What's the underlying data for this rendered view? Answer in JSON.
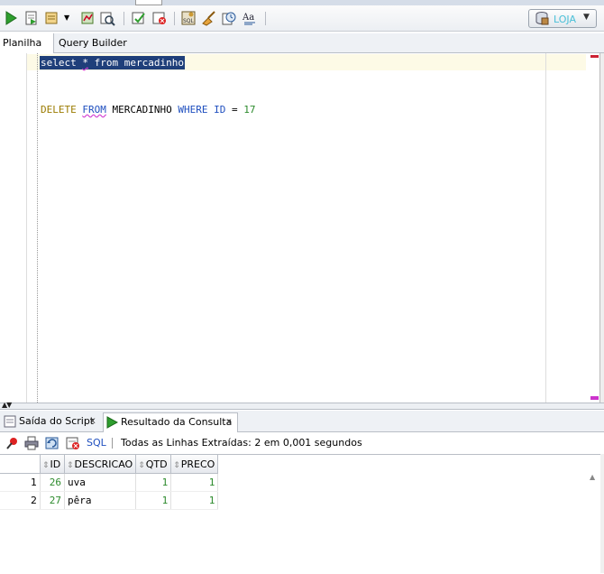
{
  "toolbar": {
    "icons": [
      "run-statement-icon",
      "run-script-icon",
      "commit-dropdown-icon",
      "explain-plan-icon",
      "autotrace-icon",
      "commit-icon",
      "rollback-icon",
      "sql-tuning-icon",
      "clear-icon",
      "history-icon",
      "format-icon"
    ],
    "connection_label": "LOJA"
  },
  "subtabs": {
    "worksheet": "Planilha",
    "query_builder": "Query Builder"
  },
  "editor": {
    "line1": {
      "kw1": "select",
      "star": "*",
      "kw2": "from",
      "table": "mercadinho"
    },
    "line2": {
      "kw1": "DELETE",
      "kw2": "FROM",
      "table": "MERCADINHO",
      "kw3": "WHERE",
      "col": "ID",
      "op": "=",
      "val": "17"
    }
  },
  "output_tabs": {
    "script_output": "Saída do Script",
    "query_result": "Resultado da Consulta",
    "close_glyph": "x"
  },
  "results_toolbar": {
    "sql_label": "SQL",
    "status": "Todas as Linhas Extraídas: 2 em 0,001 segundos"
  },
  "grid": {
    "columns": [
      "ID",
      "DESCRICAO",
      "QTD",
      "PRECO"
    ],
    "rows": [
      {
        "n": "1",
        "id": "26",
        "descricao": "uva",
        "qtd": "1",
        "preco": "1"
      },
      {
        "n": "2",
        "id": "27",
        "descricao": "pêra",
        "qtd": "1",
        "preco": "1"
      }
    ]
  },
  "colors": {
    "selection": "#1f3f7a",
    "keyword_dark": "#9b7b00",
    "keyword_blue": "#1f4fbf",
    "number": "#2b8a2b",
    "connection": "#4ac0d8"
  }
}
